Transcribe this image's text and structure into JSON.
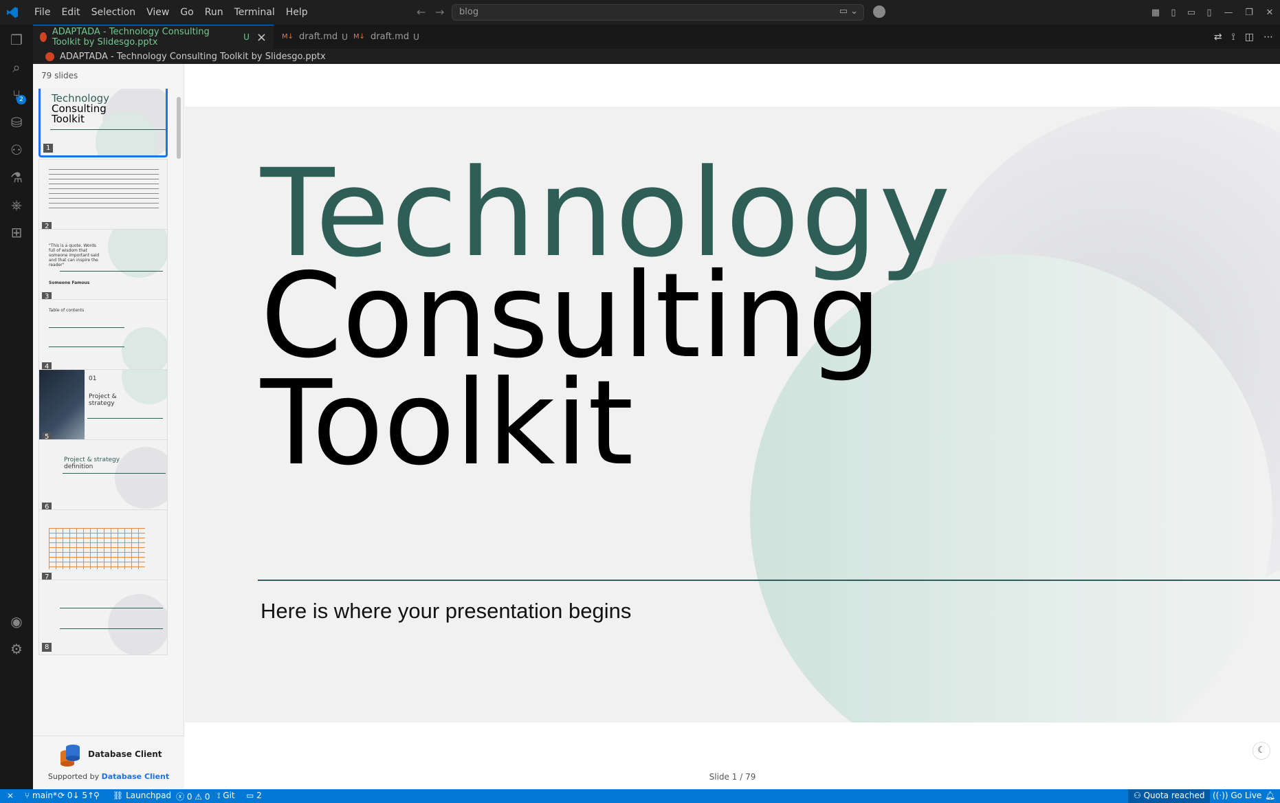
{
  "menu": [
    "File",
    "Edit",
    "Selection",
    "View",
    "Go",
    "Run",
    "Terminal",
    "Help"
  ],
  "command_center": {
    "text": "blog"
  },
  "activity_bar": {
    "source_control_badge": "2"
  },
  "tabs": [
    {
      "label": "ADAPTADA - Technology Consulting Toolkit by Slidesgo.pptx",
      "status": "U"
    },
    {
      "label": "draft.md",
      "status": "U"
    },
    {
      "label": "draft.md",
      "status": "U"
    }
  ],
  "breadcrumb": "ADAPTADA - Technology Consulting Toolkit by Slidesgo.pptx",
  "slides_panel": {
    "count_label": "79 slides",
    "thumbs": [
      {
        "num": "1",
        "title_a": "Technology",
        "title_b": "Consulting",
        "title_c": "Toolkit"
      },
      {
        "num": "2"
      },
      {
        "num": "3",
        "quote": "\"This is a quote. Words full of wisdom that someone important said and that can inspire the reader\"",
        "author": "Someone Famous"
      },
      {
        "num": "4",
        "title": "Table of contents"
      },
      {
        "num": "5",
        "number": "01",
        "title": "Project & strategy"
      },
      {
        "num": "6",
        "title_a": "Project & strategy",
        "title_b": "definition"
      },
      {
        "num": "7"
      },
      {
        "num": "8"
      }
    ]
  },
  "db_client": {
    "name": "Database Client",
    "supported_prefix": "Supported by ",
    "supported_link": "Database Client"
  },
  "slide": {
    "line1": "Technology",
    "line2": "Consulting",
    "line3": "Toolkit",
    "subtitle": "Here is where your presentation begins"
  },
  "slide_indicator": "Slide 1 / 79",
  "statusbar": {
    "branch": "main*",
    "sync": "0↓ 5↑",
    "launchpad": "Launchpad",
    "errors": "0",
    "warnings": "0",
    "git": "Git",
    "ports": "2",
    "quota": "Quota reached",
    "golive": "Go Live"
  }
}
